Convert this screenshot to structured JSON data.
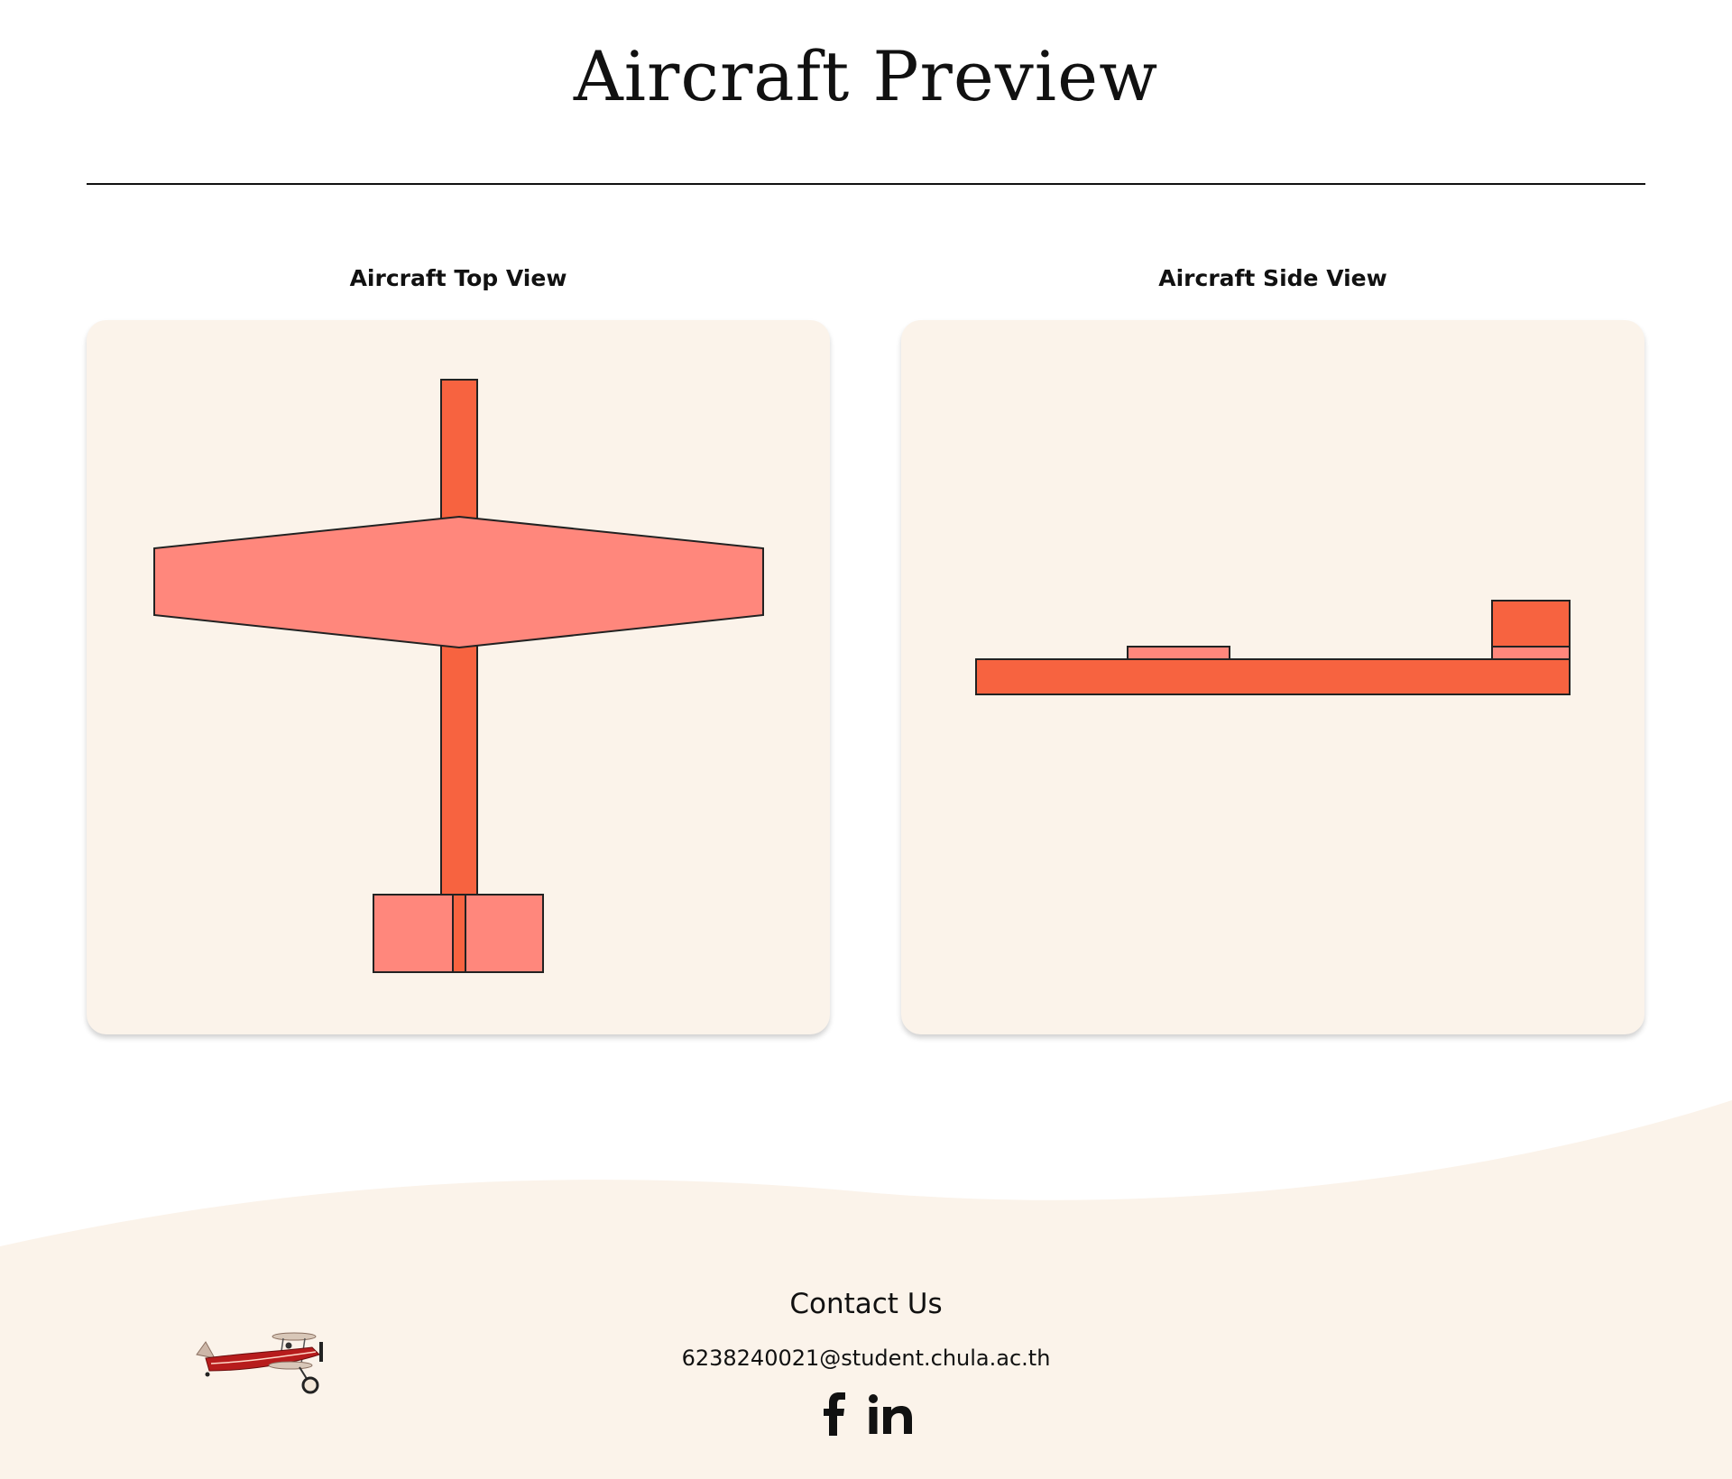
{
  "page": {
    "title": "Aircraft Preview"
  },
  "top_view": {
    "heading": "Aircraft Top View"
  },
  "side_view": {
    "heading": "Aircraft Side View"
  },
  "footer": {
    "contact_title": "Contact Us",
    "email": "6238240021@student.chula.ac.th",
    "social": [
      {
        "name": "facebook",
        "icon": "facebook-icon"
      },
      {
        "name": "linkedin",
        "icon": "linkedin-icon"
      }
    ],
    "logo_icon": "biplane-logo"
  },
  "colors": {
    "card_background": "#fbf3ea",
    "fuselage": "#f76340",
    "wing": "#ff877c",
    "outline": "#222222",
    "text": "#111111"
  }
}
